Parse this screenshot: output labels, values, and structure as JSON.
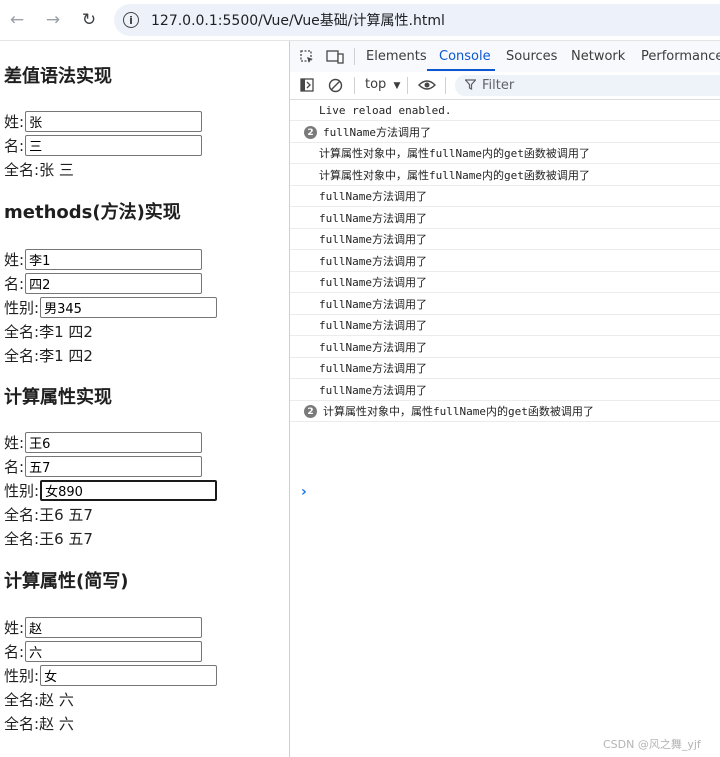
{
  "browser": {
    "url": "127.0.0.1:5500/Vue/Vue基础/计算属性.html",
    "back_icon": "arrow-left-icon",
    "forward_icon": "arrow-right-icon",
    "reload_icon": "reload-icon"
  },
  "sections": {
    "interp": {
      "title": "差值语法实现",
      "last_label": "姓:",
      "last_value": "张",
      "first_label": "名:",
      "first_value": "三",
      "full_label": "全名:",
      "full_value": "张 三"
    },
    "methods": {
      "title": "methods(方法)实现",
      "last_label": "姓:",
      "last_value": "李1",
      "first_label": "名:",
      "first_value": "四2",
      "gender_label": "性别:",
      "gender_value": "男345",
      "full_label_1": "全名:",
      "full_value_1": "李1 四2",
      "full_label_2": "全名:",
      "full_value_2": "李1 四2"
    },
    "computed": {
      "title": "计算属性实现",
      "last_label": "姓:",
      "last_value": "王6",
      "first_label": "名:",
      "first_value": "五7",
      "gender_label": "性别:",
      "gender_value": "女890",
      "full_label_1": "全名:",
      "full_value_1": "王6 五7",
      "full_label_2": "全名:",
      "full_value_2": "王6 五7"
    },
    "short": {
      "title": "计算属性(简写)",
      "last_label": "姓:",
      "last_value": "赵",
      "first_label": "名:",
      "first_value": "六",
      "gender_label": "性别:",
      "gender_value": "女",
      "full_label_1": "全名:",
      "full_value_1": "赵 六",
      "full_label_2": "全名:",
      "full_value_2": "赵 六"
    }
  },
  "devtools": {
    "tabs": {
      "elements": "Elements",
      "console": "Console",
      "sources": "Sources",
      "network": "Network",
      "performance": "Performance"
    },
    "active_tab": "Console",
    "context": "top",
    "filter_placeholder": "Filter",
    "accent_color": "#0b57d0",
    "logs": [
      {
        "text": "Live reload enabled.",
        "count": ""
      },
      {
        "text": "fullName方法调用了",
        "count": "2"
      },
      {
        "text": "计算属性对象中，属性fullName内的get函数被调用了",
        "count": ""
      },
      {
        "text": "计算属性对象中，属性fullName内的get函数被调用了",
        "count": ""
      },
      {
        "text": "fullName方法调用了",
        "count": ""
      },
      {
        "text": "fullName方法调用了",
        "count": ""
      },
      {
        "text": "fullName方法调用了",
        "count": ""
      },
      {
        "text": "fullName方法调用了",
        "count": ""
      },
      {
        "text": "fullName方法调用了",
        "count": ""
      },
      {
        "text": "fullName方法调用了",
        "count": ""
      },
      {
        "text": "fullName方法调用了",
        "count": ""
      },
      {
        "text": "fullName方法调用了",
        "count": ""
      },
      {
        "text": "fullName方法调用了",
        "count": ""
      },
      {
        "text": "fullName方法调用了",
        "count": ""
      },
      {
        "text": "计算属性对象中，属性fullName内的get函数被调用了",
        "count": "2"
      }
    ]
  },
  "watermark": "CSDN @风之舞_yjf"
}
